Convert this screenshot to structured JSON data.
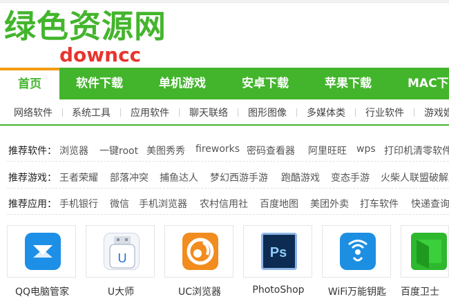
{
  "logo": {
    "title": "绿色资源网",
    "subtitle": "downcc"
  },
  "nav": {
    "items": [
      "首页",
      "软件下载",
      "单机游戏",
      "安卓下载",
      "苹果下载",
      "MAC下载"
    ]
  },
  "subnav": {
    "items": [
      "网络软件",
      "系统工具",
      "应用软件",
      "聊天联络",
      "图形图像",
      "多媒体类",
      "行业软件",
      "游戏娱乐"
    ]
  },
  "recommend": {
    "software": {
      "label": "推荐软件：",
      "links": [
        "浏览器",
        "一键root",
        "美图秀秀",
        "fireworks",
        "密码查看器",
        "阿里旺旺",
        "wps",
        "打印机清零软件"
      ]
    },
    "games": {
      "label": "推荐游戏：",
      "links": [
        "王者荣耀",
        "部落冲突",
        "捕鱼达人",
        "梦幻西游手游",
        "跑酷游戏",
        "变态手游",
        "火柴人联盟破解版"
      ]
    },
    "apps": {
      "label": "推荐应用：",
      "links": [
        "手机银行",
        "微信",
        "手机浏览器",
        "农村信用社",
        "百度地图",
        "美团外卖",
        "打车软件",
        "快递查询"
      ]
    }
  },
  "apps": [
    {
      "name": "QQ电脑管家",
      "icon": "qq-pc-manager-icon",
      "color": "#1e8fe6"
    },
    {
      "name": "U大师",
      "icon": "u-master-usb-icon",
      "color": "#3a7fd5"
    },
    {
      "name": "UC浏览器",
      "icon": "uc-browser-icon",
      "color": "#f28c1e"
    },
    {
      "name": "PhotoShop",
      "icon": "photoshop-icon",
      "color": "#0c2c54"
    },
    {
      "name": "WiFi万能钥匙",
      "icon": "wifi-key-icon",
      "color": "#1d8fe2"
    },
    {
      "name": "百度卫士",
      "icon": "baidu-guard-icon",
      "color": "#2eb82e"
    }
  ],
  "colors": {
    "brand_green": "#43b52c",
    "accent_orange": "#f39c12",
    "logo_red": "#e8342e"
  }
}
